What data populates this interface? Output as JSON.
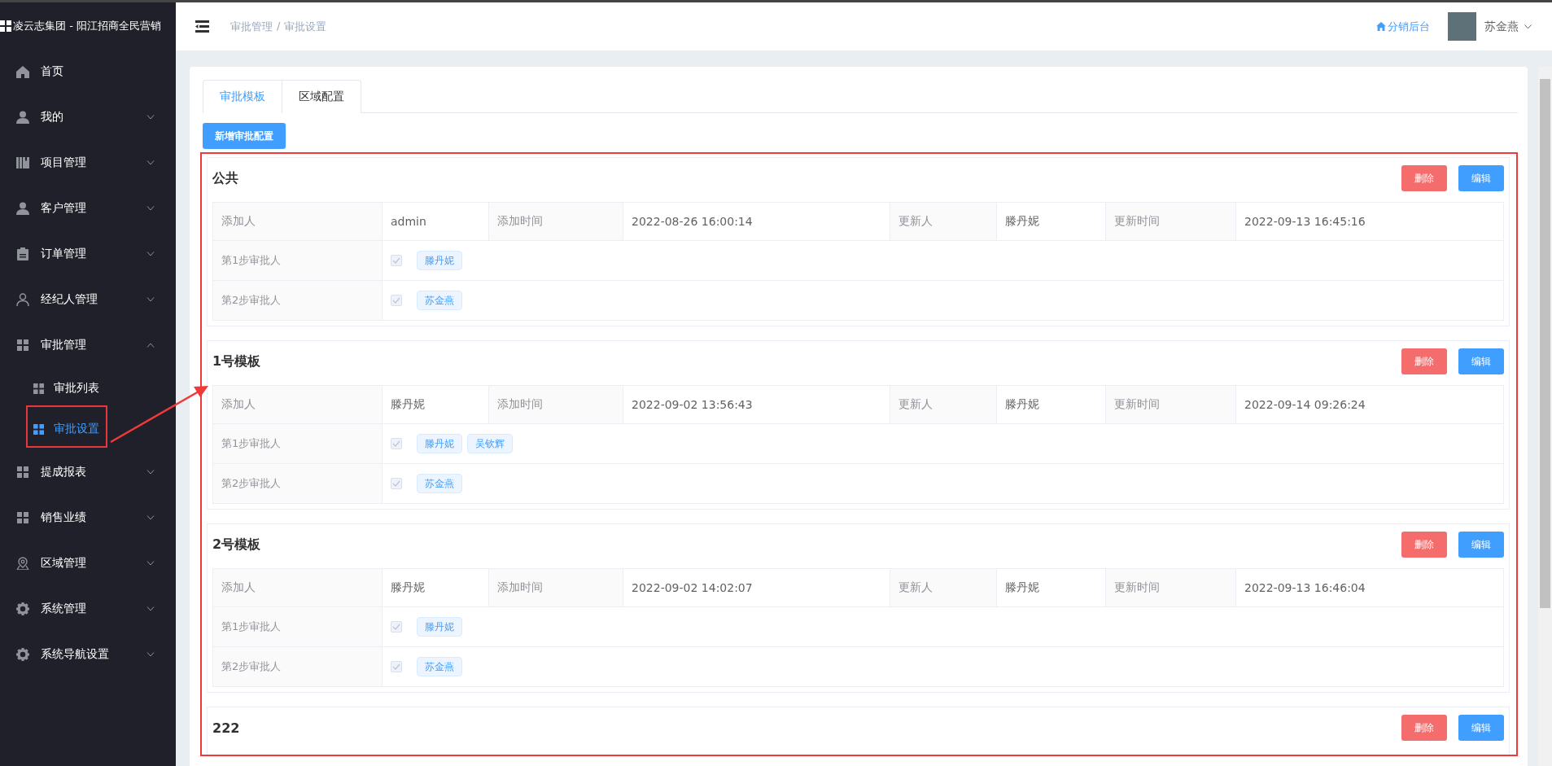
{
  "sidebar": {
    "logo": "凌云志集团 - 阳江招商全民营销",
    "items": [
      {
        "label": "首页",
        "kind": "link",
        "selected": false
      },
      {
        "label": "我的",
        "kind": "submenu",
        "expanded": false,
        "selected": false
      },
      {
        "label": "项目管理",
        "kind": "submenu",
        "expanded": false,
        "selected": false
      },
      {
        "label": "客户管理",
        "kind": "submenu",
        "expanded": false,
        "selected": false
      },
      {
        "label": "订单管理",
        "kind": "submenu",
        "expanded": false,
        "selected": false
      },
      {
        "label": "经纪人管理",
        "kind": "submenu",
        "expanded": false,
        "selected": false
      },
      {
        "label": "审批管理",
        "kind": "submenu",
        "expanded": true,
        "selected": false,
        "children": [
          {
            "label": "审批列表",
            "selected": false
          },
          {
            "label": "审批设置",
            "selected": true
          }
        ]
      },
      {
        "label": "提成报表",
        "kind": "submenu",
        "expanded": false,
        "selected": false
      },
      {
        "label": "销售业绩",
        "kind": "submenu",
        "expanded": false,
        "selected": false
      },
      {
        "label": "区域管理",
        "kind": "submenu",
        "expanded": false,
        "selected": false
      },
      {
        "label": "系统管理",
        "kind": "submenu",
        "expanded": false,
        "selected": false
      },
      {
        "label": "系统导航设置",
        "kind": "submenu",
        "expanded": false,
        "selected": false
      }
    ]
  },
  "header": {
    "breadcrumb": [
      "审批管理",
      "审批设置"
    ],
    "separator": "/",
    "link": "分销后台",
    "user": "苏金燕"
  },
  "tabs": [
    {
      "label": "审批模板",
      "selected": true
    },
    {
      "label": "区域配置",
      "selected": false
    }
  ],
  "add_button": "新增审批配置",
  "templates": [
    {
      "title": "公共",
      "delete": "删除",
      "edit": "编辑",
      "info": [
        {
          "label": "添加人",
          "value": "admin"
        },
        {
          "label": "添加时间",
          "value": "2022-08-26 16:00:14"
        },
        {
          "label": "更新人",
          "value": "滕丹妮"
        },
        {
          "label": "更新时间",
          "value": "2022-09-13 16:45:16"
        }
      ],
      "steps": [
        {
          "label": "第1步审批人",
          "checked": true,
          "disabled": true,
          "approvers": [
            "滕丹妮"
          ]
        },
        {
          "label": "第2步审批人",
          "checked": true,
          "disabled": true,
          "approvers": [
            "苏金燕"
          ]
        }
      ]
    },
    {
      "title": "1号模板",
      "delete": "删除",
      "edit": "编辑",
      "info": [
        {
          "label": "添加人",
          "value": "滕丹妮"
        },
        {
          "label": "添加时间",
          "value": "2022-09-02 13:56:43"
        },
        {
          "label": "更新人",
          "value": "滕丹妮"
        },
        {
          "label": "更新时间",
          "value": "2022-09-14 09:26:24"
        }
      ],
      "steps": [
        {
          "label": "第1步审批人",
          "checked": true,
          "disabled": true,
          "approvers": [
            "滕丹妮",
            "吴钦辉"
          ]
        },
        {
          "label": "第2步审批人",
          "checked": true,
          "disabled": true,
          "approvers": [
            "苏金燕"
          ]
        }
      ]
    },
    {
      "title": "2号模板",
      "delete": "删除",
      "edit": "编辑",
      "info": [
        {
          "label": "添加人",
          "value": "滕丹妮"
        },
        {
          "label": "添加时间",
          "value": "2022-09-02 14:02:07"
        },
        {
          "label": "更新人",
          "value": "滕丹妮"
        },
        {
          "label": "更新时间",
          "value": "2022-09-13 16:46:04"
        }
      ],
      "steps": [
        {
          "label": "第1步审批人",
          "checked": true,
          "disabled": true,
          "approvers": [
            "滕丹妮"
          ]
        },
        {
          "label": "第2步审批人",
          "checked": true,
          "disabled": true,
          "approvers": [
            "苏金燕"
          ]
        }
      ]
    },
    {
      "title": "222",
      "delete": "删除",
      "edit": "编辑"
    }
  ]
}
